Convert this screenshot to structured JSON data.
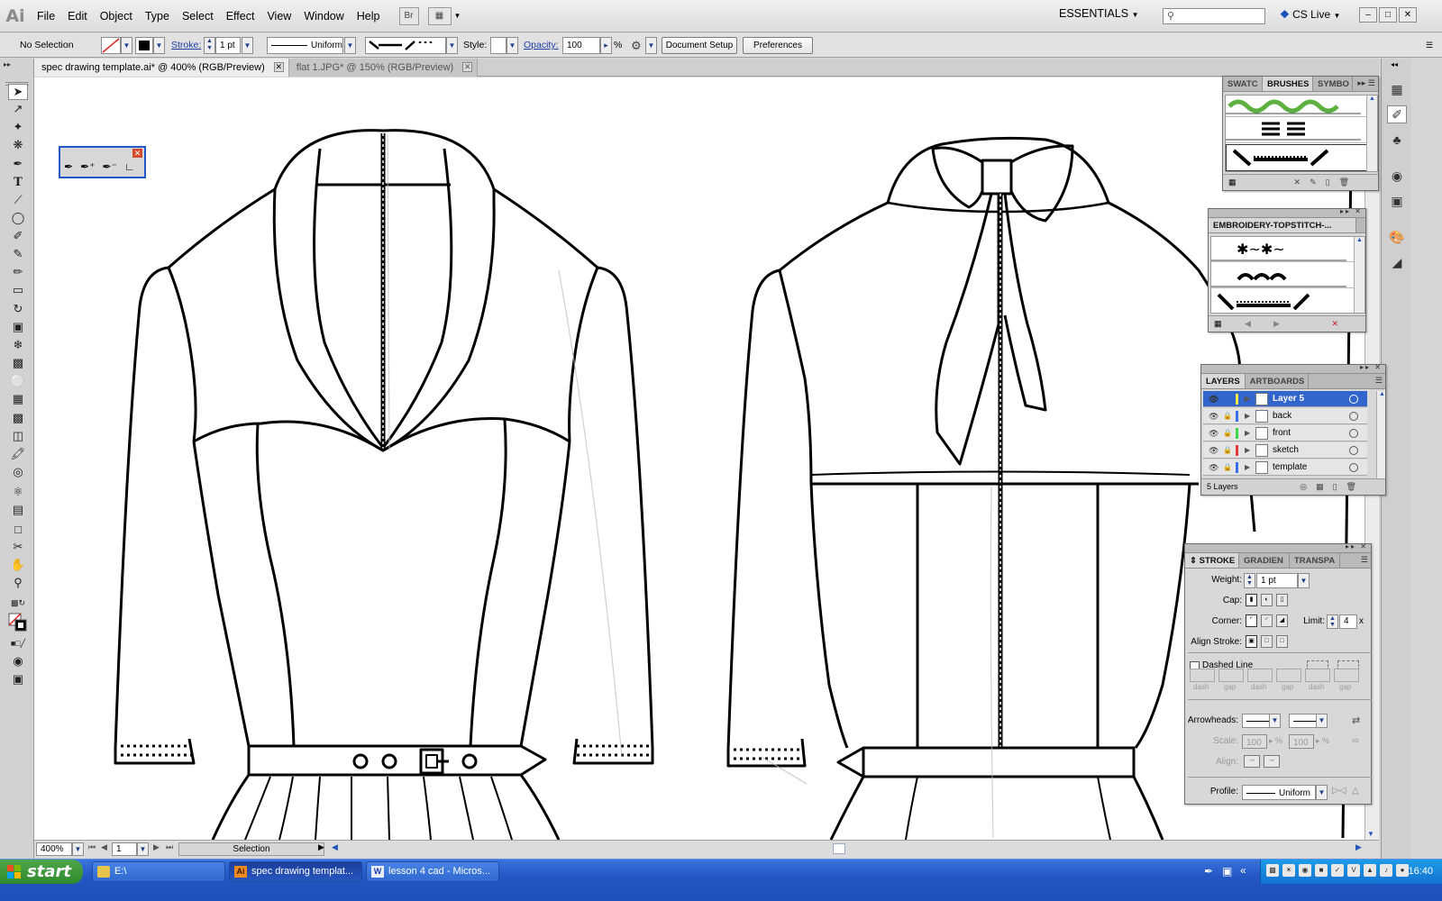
{
  "menubar": {
    "logo": "Ai",
    "items": [
      "File",
      "Edit",
      "Object",
      "Type",
      "Select",
      "Effect",
      "View",
      "Window",
      "Help"
    ],
    "bridge_label": "Br",
    "workspace": "ESSENTIALS",
    "cs_live": "CS Live"
  },
  "control": {
    "selection_status": "No Selection",
    "stroke_label": "Stroke:",
    "stroke_weight": "1 pt",
    "profile": "Uniform",
    "style_label": "Style:",
    "opacity_label": "Opacity:",
    "opacity_value": "100",
    "percent": "%",
    "document_setup": "Document Setup",
    "preferences": "Preferences"
  },
  "tabs": [
    {
      "label": "spec drawing template.ai* @ 400% (RGB/Preview)"
    },
    {
      "label": "flat 1.JPG* @ 150% (RGB/Preview)"
    }
  ],
  "brushes_panel": {
    "tabs": [
      "SWATC",
      "BRUSHES",
      "SYMBO"
    ]
  },
  "embroidery_panel": {
    "title": "EMBROIDERY-TOPSTITCH-..."
  },
  "layers_panel": {
    "tabs": [
      "LAYERS",
      "ARTBOARDS"
    ],
    "layers": [
      {
        "name": "Layer 5",
        "color": "#f4e84a"
      },
      {
        "name": "back",
        "color": "#3a6ee8"
      },
      {
        "name": "front",
        "color": "#3ad84a"
      },
      {
        "name": "sketch",
        "color": "#e83a3a"
      },
      {
        "name": "template",
        "color": "#3a6ee8"
      }
    ],
    "footer": "5 Layers"
  },
  "stroke_panel": {
    "tabs": [
      "STROKE",
      "GRADIEN",
      "TRANSPA"
    ],
    "weight_label": "Weight:",
    "weight_value": "1 pt",
    "cap_label": "Cap:",
    "corner_label": "Corner:",
    "limit_label": "Limit:",
    "limit_value": "4",
    "limit_unit": "x",
    "align_label": "Align Stroke:",
    "dashed_label": "Dashed Line",
    "dash_labels": [
      "dash",
      "gap",
      "dash",
      "gap",
      "dash",
      "gap"
    ],
    "arrowheads_label": "Arrowheads:",
    "scale_label": "Scale:",
    "scale_values": [
      "100",
      "100"
    ],
    "align2_label": "Align:",
    "profile_label": "Profile:",
    "profile_value": "Uniform"
  },
  "statusbar": {
    "zoom": "400%",
    "artboard": "1",
    "tool": "Selection"
  },
  "taskbar": {
    "start": "start",
    "buttons": [
      {
        "label": "E:\\",
        "icon": "folder-icon"
      },
      {
        "label": "spec drawing templat...",
        "icon": "illustrator-icon"
      },
      {
        "label": "lesson 4 cad - Micros...",
        "icon": "word-icon"
      }
    ],
    "clock": "16:40"
  },
  "colors": {
    "accent_blue": "#3366cc",
    "taskbar_blue": "#2457c4",
    "start_green": "#3a9a36"
  }
}
